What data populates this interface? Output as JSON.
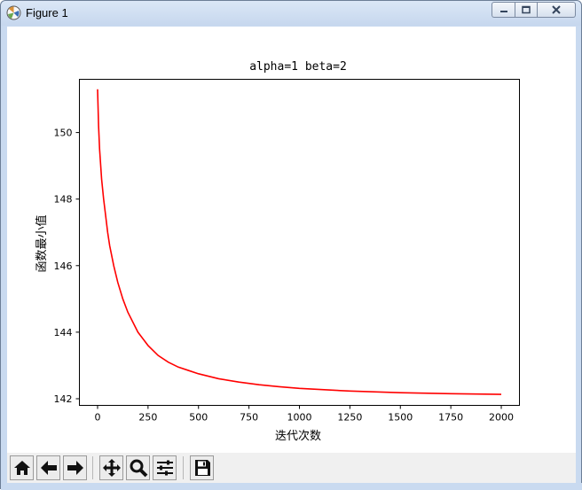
{
  "window": {
    "title": "Figure 1"
  },
  "caption_buttons": [
    "minimize-icon",
    "maximize-icon",
    "close-icon"
  ],
  "toolbar": {
    "buttons": [
      "home-icon",
      "back-arrow-icon",
      "forward-arrow-icon",
      "pan-icon",
      "zoom-icon",
      "configure-subplots-icon",
      "save-icon"
    ]
  },
  "chart_data": {
    "type": "line",
    "title": "alpha=1  beta=2",
    "xlabel": "迭代次数",
    "ylabel": "函数最小值",
    "xlim": [
      -90,
      2090
    ],
    "ylim": [
      141.8,
      151.6
    ],
    "xticks": [
      0,
      250,
      500,
      750,
      1000,
      1250,
      1500,
      1750,
      2000
    ],
    "xtick_labels": [
      "0",
      "250",
      "500",
      "750",
      "1000",
      "1250",
      "1500",
      "1750",
      "2000"
    ],
    "yticks": [
      142,
      144,
      146,
      148,
      150
    ],
    "ytick_labels": [
      "142",
      "144",
      "146",
      "148",
      "150"
    ],
    "grid": false,
    "series": [
      {
        "color": "#ff0000",
        "x": [
          0,
          5,
          10,
          20,
          30,
          40,
          50,
          60,
          80,
          100,
          125,
          150,
          175,
          200,
          250,
          300,
          350,
          400,
          450,
          500,
          600,
          700,
          800,
          900,
          1000,
          1250,
          1500,
          1750,
          2000
        ],
        "y": [
          151.3,
          150.2,
          149.5,
          148.6,
          148.0,
          147.5,
          147.0,
          146.6,
          146.0,
          145.5,
          145.0,
          144.6,
          144.3,
          144.0,
          143.6,
          143.3,
          143.1,
          142.95,
          142.85,
          142.75,
          142.6,
          142.5,
          142.42,
          142.36,
          142.31,
          142.23,
          142.18,
          142.15,
          142.13
        ]
      }
    ]
  }
}
